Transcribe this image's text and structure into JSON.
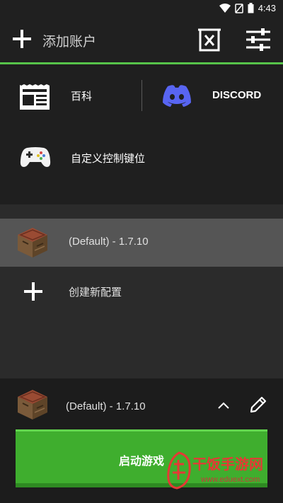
{
  "status_bar": {
    "time": "4:43"
  },
  "toolbar": {
    "add_account_label": "添加账户"
  },
  "links": {
    "wiki_label": "百科",
    "discord_label": "DISCORD",
    "custom_controls_label": "自定义控制键位"
  },
  "profiles": {
    "items": [
      {
        "name": "(Default) - 1.7.10"
      }
    ],
    "create_label": "创建新配置"
  },
  "launcher": {
    "selected_profile": "(Default) - 1.7.10",
    "play_label": "启动游戏"
  },
  "watermark": {
    "text": "干饭手游网",
    "url": "www.eduext.com"
  },
  "colors": {
    "accent_green": "#57c44a",
    "play_button": "#3fae2e",
    "discord": "#5865f2",
    "watermark_red": "#e53935"
  }
}
